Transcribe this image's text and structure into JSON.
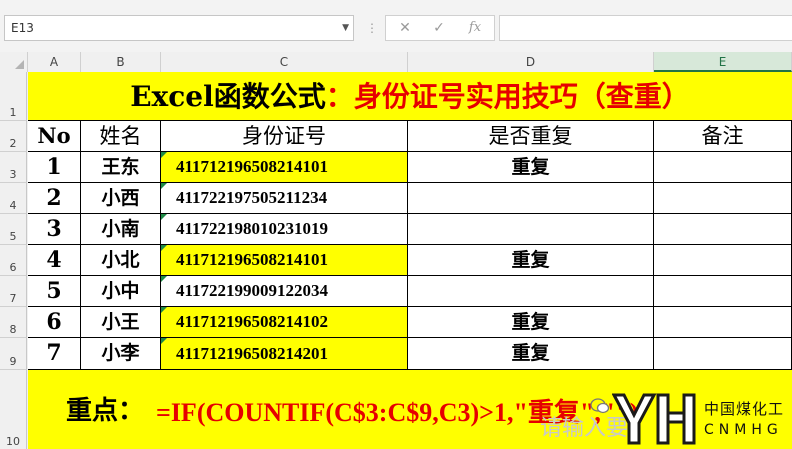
{
  "formula_bar": {
    "name_box": "E13",
    "cancel_icon": "close-icon",
    "enter_icon": "check-icon",
    "fx_label": "fx",
    "formula": ""
  },
  "columns": [
    "A",
    "B",
    "C",
    "D",
    "E"
  ],
  "selected_column": "E",
  "rows": [
    "1",
    "2",
    "3",
    "4",
    "5",
    "6",
    "7",
    "8",
    "9",
    "10"
  ],
  "sheet": {
    "title_black_1": "Excel函数公式",
    "title_red": "：身份证号实用技巧（查重）",
    "headers": [
      "No",
      "姓名",
      "身份证号",
      "是否重复",
      "备注"
    ],
    "records": [
      {
        "no": "1",
        "name": "王东",
        "id": "411712196508214101",
        "dup": "重复",
        "note": "",
        "highlight": true
      },
      {
        "no": "2",
        "name": "小西",
        "id": "411722197505211234",
        "dup": "",
        "note": "",
        "highlight": false
      },
      {
        "no": "3",
        "name": "小南",
        "id": "411722198010231019",
        "dup": "",
        "note": "",
        "highlight": false
      },
      {
        "no": "4",
        "name": "小北",
        "id": "411712196508214101",
        "dup": "重复",
        "note": "",
        "highlight": true
      },
      {
        "no": "5",
        "name": "小中",
        "id": "411722199009122034",
        "dup": "",
        "note": "",
        "highlight": false
      },
      {
        "no": "6",
        "name": "小王",
        "id": "411712196508214102",
        "dup": "重复",
        "note": "",
        "highlight": true
      },
      {
        "no": "7",
        "name": "小李",
        "id": "411712196508214201",
        "dup": "重复",
        "note": "",
        "highlight": true
      }
    ],
    "formula_label": "重点：",
    "formula_text": "=IF(COUNTIF(C$3:C$9,C3)>1,\"重复\",\"\")"
  },
  "overlay": {
    "input_hint": "请输入要",
    "logo_cn": "中国煤化工",
    "logo_en": "CNMHG"
  },
  "colors": {
    "highlight": "#ffff00",
    "red_text": "#e60000",
    "selected_header": "#217346"
  }
}
